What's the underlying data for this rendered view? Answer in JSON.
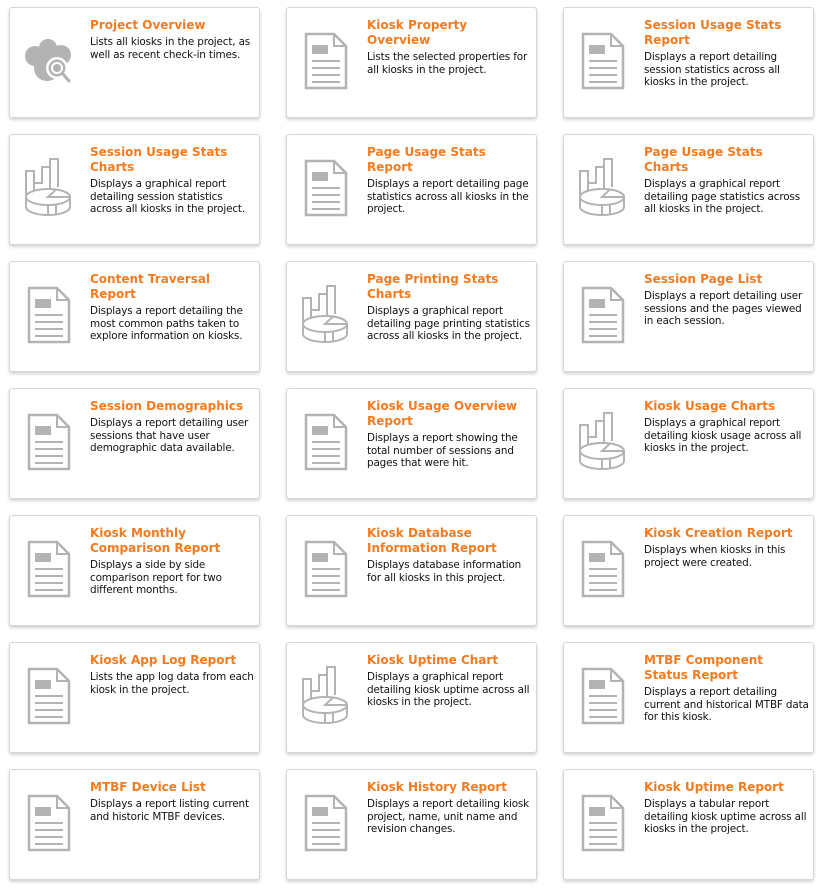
{
  "colors": {
    "title": "#f47b20",
    "icon": "#b3b3b3",
    "border": "#d6d6d6"
  },
  "cards": [
    {
      "title": "Project Overview",
      "description": "Lists all kiosks in the project, as well as recent check-in times.",
      "icon": "cloud-search-icon"
    },
    {
      "title": "Kiosk Property Overview",
      "description": "Lists the selected properties for all kiosks in the project.",
      "icon": "document-icon"
    },
    {
      "title": "Session Usage Stats Report",
      "description": "Displays a report detailing session statistics across all kiosks in the project.",
      "icon": "document-icon"
    },
    {
      "title": "Session Usage Stats Charts",
      "description": "Displays a graphical report detailing session statistics across all kiosks in the project.",
      "icon": "chart-icon"
    },
    {
      "title": "Page Usage Stats Report",
      "description": "Displays a report detailing page statistics across all kiosks in the project.",
      "icon": "document-icon"
    },
    {
      "title": "Page Usage Stats Charts",
      "description": "Displays a graphical report detailing page statistics across all kiosks in the project.",
      "icon": "chart-icon"
    },
    {
      "title": "Content Traversal Report",
      "description": "Displays a report detailing the most common paths taken to explore information on kiosks.",
      "icon": "document-icon"
    },
    {
      "title": "Page Printing Stats Charts",
      "description": "Displays a graphical report detailing page printing statistics across all kiosks in the project.",
      "icon": "chart-icon"
    },
    {
      "title": "Session Page List",
      "description": "Displays a report detailing user sessions and the pages viewed in each session.",
      "icon": "document-icon"
    },
    {
      "title": "Session Demographics",
      "description": "Displays a report detailing user sessions that have user demographic data available.",
      "icon": "document-icon"
    },
    {
      "title": "Kiosk Usage Overview Report",
      "description": "Displays a report showing the total number of sessions and pages that were hit.",
      "icon": "document-icon"
    },
    {
      "title": "Kiosk Usage Charts",
      "description": "Displays a graphical report detailing kiosk usage across all kiosks in the project.",
      "icon": "chart-icon"
    },
    {
      "title": "Kiosk Monthly Comparison Report",
      "description": "Displays a side by side comparison report for two different months.",
      "icon": "document-icon"
    },
    {
      "title": "Kiosk Database Information Report",
      "description": "Displays database information for all kiosks in this project.",
      "icon": "document-icon"
    },
    {
      "title": "Kiosk Creation Report",
      "description": "Displays when kiosks in this project were created.",
      "icon": "document-icon"
    },
    {
      "title": "Kiosk App Log Report",
      "description": "Lists the app log data from each kiosk in the project.",
      "icon": "document-icon"
    },
    {
      "title": "Kiosk Uptime Chart",
      "description": "Displays a graphical report detailing kiosk uptime across all kiosks in the project.",
      "icon": "chart-icon"
    },
    {
      "title": "MTBF Component Status Report",
      "description": "Displays a report detailing current and historical MTBF data for this kiosk.",
      "icon": "document-icon"
    },
    {
      "title": "MTBF Device List",
      "description": "Displays a report listing current and historic MTBF devices.",
      "icon": "document-icon"
    },
    {
      "title": "Kiosk History Report",
      "description": "Displays a report detailing kiosk project, name, unit name and revision changes.",
      "icon": "document-icon"
    },
    {
      "title": "Kiosk Uptime Report",
      "description": "Displays a tabular report detailing kiosk uptime across all kiosks in the project.",
      "icon": "document-icon"
    }
  ]
}
